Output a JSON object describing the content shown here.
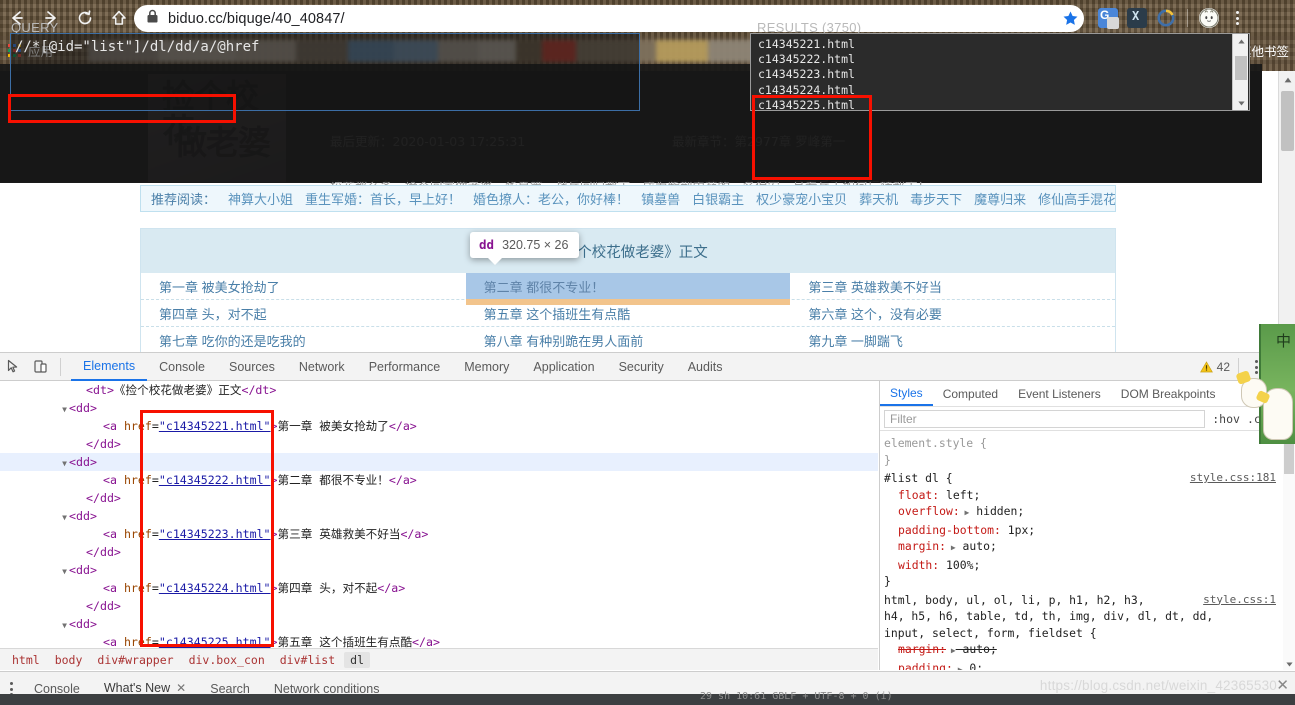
{
  "browser": {
    "url": "biduo.cc/biquge/40_40847/",
    "nav": {
      "back": "back-arrow",
      "forward": "forward-arrow",
      "reload": "reload",
      "home": "home"
    },
    "lock_icon": "lock-icon",
    "star_icon": "bookmark-star-icon",
    "menu_icon": "three-dot-menu",
    "apps_label": "应用",
    "other_bookmarks_label": "其他书签"
  },
  "page": {
    "last_update_label": "最后更新：2020-01-03 17:25:31",
    "latest_chapter_label": "最新章节：第2977章  罗峰第一",
    "cover_title_line1": "捡个校花",
    "cover_title_line2": "做老婆",
    "intro_line1": "校花那么多，捡个回家做老婆，华夏第一战兵回归都市，成为紫荆中苑的一名保安，且看兵王如何玩转都市！",
    "intro_line2": "各位书友要是觉得《捡个校花做老婆》还不错的话请不要忘记向您QQ群和微博里的朋友推荐哦！",
    "recommend_title": "推荐阅读：",
    "recommend_links": [
      "神算大小姐",
      "重生军婚：首长，早上好！",
      "婚色撩人：老公，你好棒！",
      "镇墓兽",
      "白银霸主",
      "权少豪宠小宝贝",
      "葬天机",
      "毒步天下",
      "魔尊归来",
      "修仙高手混花都"
    ],
    "list_header": "《捡个校花做老婆》正文",
    "chapters": [
      [
        "第一章  被美女抢劫了",
        "第二章  都很不专业！",
        "第三章  英雄救美不好当"
      ],
      [
        "第四章  头，对不起",
        "第五章  这个插班生有点酷",
        "第六章  这个，没有必要"
      ],
      [
        "第七章  吃你的还是吃我的",
        "第八章  有种别跪在男人面前",
        "第九章  一脚踹飞"
      ]
    ],
    "highlight_row": 0,
    "highlight_col": 1
  },
  "xpath_helper": {
    "query_label": "QUERY",
    "query_value": "//*[@id=\"list\"]/dl/dd/a/@href",
    "results_label": "RESULTS (3750)",
    "results": [
      "c14345221.html",
      "c14345222.html",
      "c14345223.html",
      "c14345224.html",
      "c14345225.html"
    ]
  },
  "element_tooltip": {
    "tag": "dd",
    "dimensions": "320.75 × 26"
  },
  "devtools": {
    "tabs": [
      {
        "label": "Elements",
        "active": true
      },
      {
        "label": "Console",
        "active": false
      },
      {
        "label": "Sources",
        "active": false
      },
      {
        "label": "Network",
        "active": false
      },
      {
        "label": "Performance",
        "active": false
      },
      {
        "label": "Memory",
        "active": false
      },
      {
        "label": "Application",
        "active": false
      },
      {
        "label": "Security",
        "active": false
      },
      {
        "label": "Audits",
        "active": false
      }
    ],
    "warning_count": "42",
    "inspect_icon": "inspect-element-icon",
    "device_icon": "toggle-device-toolbar-icon",
    "more_icon": "devtools-more-options",
    "close_icon": "devtools-close",
    "dom": [
      {
        "indent": 1,
        "tri": "",
        "parts": [
          {
            "t": "tag",
            "v": "<dt>"
          },
          {
            "t": "text",
            "v": "《捡个校花做老婆》正文"
          },
          {
            "t": "tag",
            "v": "</dt>"
          }
        ],
        "selected": false
      },
      {
        "indent": 0,
        "tri": "▼",
        "parts": [
          {
            "t": "tag",
            "v": "<dd>"
          }
        ],
        "selected": false
      },
      {
        "indent": 2,
        "tri": "",
        "parts": [
          {
            "t": "tag",
            "v": "<a "
          },
          {
            "t": "attr",
            "v": "href"
          },
          {
            "t": "plain",
            "v": "="
          },
          {
            "t": "val",
            "v": "\"c14345221.html\""
          },
          {
            "t": "tag",
            "v": ">"
          },
          {
            "t": "text",
            "v": "第一章  被美女抢劫了"
          },
          {
            "t": "tag",
            "v": "</a>"
          }
        ],
        "selected": false
      },
      {
        "indent": 1,
        "tri": "",
        "parts": [
          {
            "t": "tag",
            "v": "</dd>"
          }
        ],
        "selected": false
      },
      {
        "indent": 0,
        "tri": "▼",
        "parts": [
          {
            "t": "tag",
            "v": "<dd>"
          }
        ],
        "selected": true
      },
      {
        "indent": 2,
        "tri": "",
        "parts": [
          {
            "t": "tag",
            "v": "<a "
          },
          {
            "t": "attr",
            "v": "href"
          },
          {
            "t": "plain",
            "v": "="
          },
          {
            "t": "val",
            "v": "\"c14345222.html\""
          },
          {
            "t": "tag",
            "v": ">"
          },
          {
            "t": "text",
            "v": "第二章  都很不专业！"
          },
          {
            "t": "tag",
            "v": "</a>"
          }
        ],
        "selected": false
      },
      {
        "indent": 1,
        "tri": "",
        "parts": [
          {
            "t": "tag",
            "v": "</dd>"
          }
        ],
        "selected": false
      },
      {
        "indent": 0,
        "tri": "▼",
        "parts": [
          {
            "t": "tag",
            "v": "<dd>"
          }
        ],
        "selected": false
      },
      {
        "indent": 2,
        "tri": "",
        "parts": [
          {
            "t": "tag",
            "v": "<a "
          },
          {
            "t": "attr",
            "v": "href"
          },
          {
            "t": "plain",
            "v": "="
          },
          {
            "t": "val",
            "v": "\"c14345223.html\""
          },
          {
            "t": "tag",
            "v": ">"
          },
          {
            "t": "text",
            "v": "第三章  英雄救美不好当"
          },
          {
            "t": "tag",
            "v": "</a>"
          }
        ],
        "selected": false
      },
      {
        "indent": 1,
        "tri": "",
        "parts": [
          {
            "t": "tag",
            "v": "</dd>"
          }
        ],
        "selected": false
      },
      {
        "indent": 0,
        "tri": "▼",
        "parts": [
          {
            "t": "tag",
            "v": "<dd>"
          }
        ],
        "selected": false
      },
      {
        "indent": 2,
        "tri": "",
        "parts": [
          {
            "t": "tag",
            "v": "<a "
          },
          {
            "t": "attr",
            "v": "href"
          },
          {
            "t": "plain",
            "v": "="
          },
          {
            "t": "val",
            "v": "\"c14345224.html\""
          },
          {
            "t": "tag",
            "v": ">"
          },
          {
            "t": "text",
            "v": "第四章  头，对不起"
          },
          {
            "t": "tag",
            "v": "</a>"
          }
        ],
        "selected": false
      },
      {
        "indent": 1,
        "tri": "",
        "parts": [
          {
            "t": "tag",
            "v": "</dd>"
          }
        ],
        "selected": false
      },
      {
        "indent": 0,
        "tri": "▼",
        "parts": [
          {
            "t": "tag",
            "v": "<dd>"
          }
        ],
        "selected": false
      },
      {
        "indent": 2,
        "tri": "",
        "parts": [
          {
            "t": "tag",
            "v": "<a "
          },
          {
            "t": "attr",
            "v": "href"
          },
          {
            "t": "plain",
            "v": "="
          },
          {
            "t": "val",
            "v": "\"c14345225.html\""
          },
          {
            "t": "tag",
            "v": ">"
          },
          {
            "t": "text",
            "v": "第五章  这个插班生有点酷"
          },
          {
            "t": "tag",
            "v": "</a>"
          }
        ],
        "selected": false
      }
    ],
    "breadcrumb": [
      {
        "label": "html",
        "selected": false
      },
      {
        "label": "body",
        "selected": false
      },
      {
        "label": "div#wrapper",
        "selected": false
      },
      {
        "label": "div.box_con",
        "selected": false
      },
      {
        "label": "div#list",
        "selected": false
      },
      {
        "label": "dl",
        "selected": true
      }
    ],
    "styles": {
      "tabs": [
        {
          "label": "Styles",
          "active": true
        },
        {
          "label": "Computed",
          "active": false
        },
        {
          "label": "Event Listeners",
          "active": false
        },
        {
          "label": "DOM Breakpoints",
          "active": false
        }
      ],
      "filter_placeholder": "Filter",
      "hov_label": ":hov",
      "cls_label": ".cls",
      "new_rule_label": "+",
      "rules": [
        {
          "selector": "element.style {",
          "source": "",
          "declarations": [],
          "close": "}"
        },
        {
          "selector": "#list dl {",
          "source": "style.css:181",
          "declarations": [
            {
              "prop": "float",
              "value": "left;",
              "arrow": false,
              "struck": false
            },
            {
              "prop": "overflow",
              "value": "hidden;",
              "arrow": true,
              "struck": false
            },
            {
              "prop": "padding-bottom",
              "value": "1px;",
              "arrow": false,
              "struck": false
            },
            {
              "prop": "margin",
              "value": "auto;",
              "arrow": true,
              "struck": false
            },
            {
              "prop": "width",
              "value": "100%;",
              "arrow": false,
              "struck": false
            }
          ],
          "close": "}"
        },
        {
          "selector": "html, body, ul, ol, li, p, h1, h2, h3,\nh4, h5, h6, table, td, th, img, div, dl, dt, dd,\ninput, select, form, fieldset {",
          "source": "style.css:1",
          "declarations": [
            {
              "prop": "margin",
              "value": "auto;",
              "arrow": true,
              "struck": true
            },
            {
              "prop": "padding",
              "value": "0;",
              "arrow": true,
              "struck": false
            }
          ],
          "close": ""
        }
      ]
    },
    "drawer": {
      "tabs": [
        {
          "label": "Console",
          "active": false,
          "closable": false
        },
        {
          "label": "What's New",
          "active": true,
          "closable": true
        },
        {
          "label": "Search",
          "active": false,
          "closable": false
        },
        {
          "label": "Network conditions",
          "active": false,
          "closable": false
        }
      ]
    }
  },
  "watermark": {
    "text": "https://blog.csdn.net/weixin_42365530",
    "close_label": "✕"
  },
  "status_strip": "29 sh     10:61   GBLF +   UTF-8 +   0    (i)",
  "colors": {
    "accent_blue": "#1a73e8",
    "annotation_red": "#f71000",
    "chrome_brown": "#6b5840",
    "highlight_blue": "#a8c7e7",
    "highlight_orange": "#f2c48c",
    "tag_purple": "#881391",
    "attr_orange": "#994500",
    "value_blue": "#1a1aa6",
    "prop_red": "#c41a16"
  }
}
